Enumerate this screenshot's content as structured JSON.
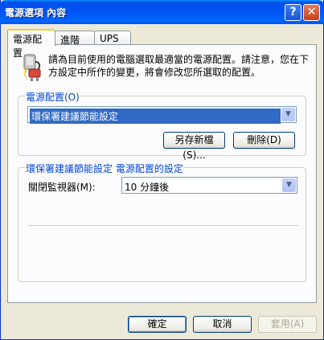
{
  "window": {
    "title": "電源選項 內容",
    "help_glyph": "?",
    "close_glyph": "✕"
  },
  "tabs": [
    {
      "label": "電源配置",
      "active": true
    },
    {
      "label": "進階",
      "active": false
    },
    {
      "label": "UPS",
      "active": false
    }
  ],
  "description": "請為目前使用的電腦選取最適當的電源配置。請注意，您在下方設定中所作的變更，將會修改您所選取的配置。",
  "scheme_group": {
    "label": "電源配置(O)",
    "selected": "環保署建議節能設定",
    "save_as_label": "另存新檔(S)...",
    "delete_label": "刪除(D)"
  },
  "settings_group": {
    "label": "環保署建議節能設定 電源配置的設定",
    "monitor_label": "關閉監視器(M):",
    "monitor_value": "10 分鐘後"
  },
  "footer": {
    "ok_label": "確定",
    "cancel_label": "取消",
    "apply_label": "套用(A)"
  },
  "colors": {
    "accent": "#0054e3",
    "group_label": "#0046d5",
    "tab_highlight": "#ffc83c"
  }
}
